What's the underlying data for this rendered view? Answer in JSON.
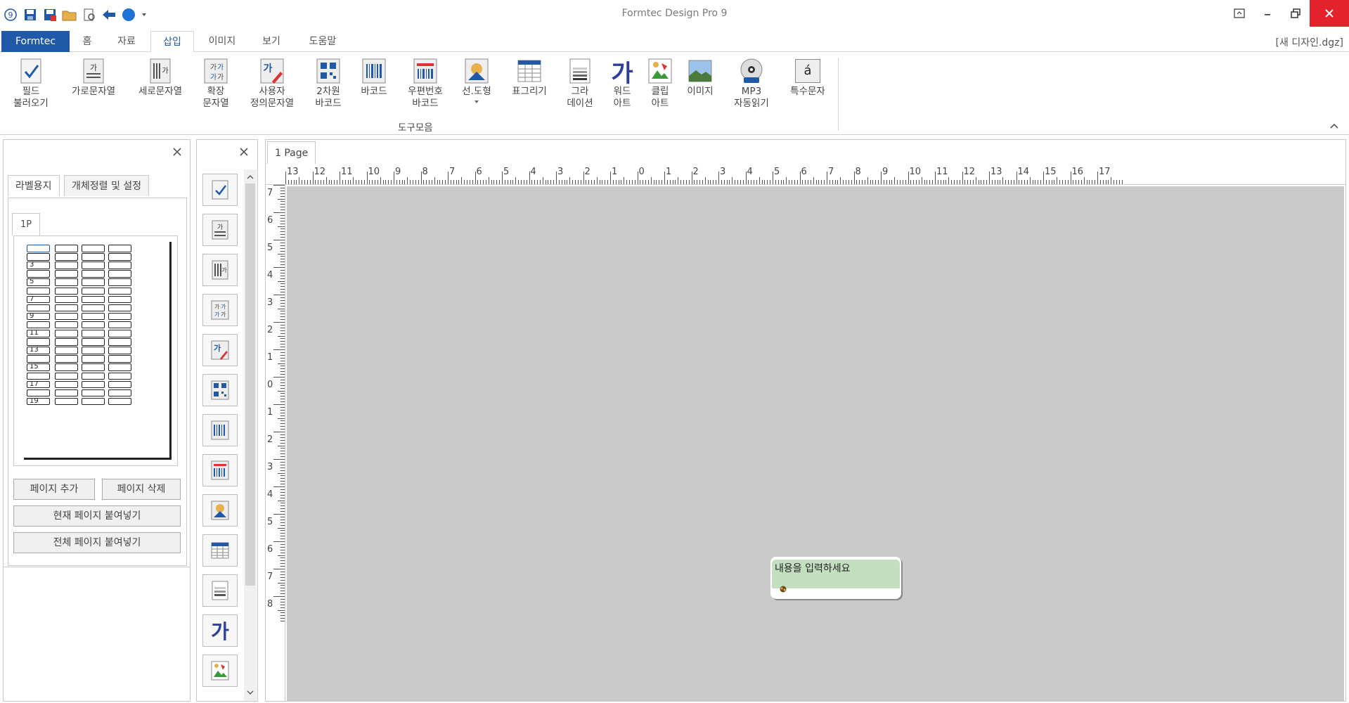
{
  "app": {
    "title": "Formtec Design Pro 9",
    "doc_name": "[새 디자인.dgz]"
  },
  "tabs": {
    "file": "Formtec",
    "home": "홈",
    "data": "자료",
    "insert": "삽입",
    "image": "이미지",
    "view": "보기",
    "help": "도움말"
  },
  "ribbon": {
    "field_load": "필드\n불러오기",
    "horizontal_text": "가로문자열",
    "vertical_text": "세로문자열",
    "extended_text": "확장\n문자열",
    "user_text": "사용자\n정의문자열",
    "barcode_2d": "2차원\n바코드",
    "barcode": "바코드",
    "postal_barcode": "우편번호\n바코드",
    "shape": "선.도형",
    "table": "표그리기",
    "gradation": "그라\n데이션",
    "word_art": "워드\n아트",
    "clip_art": "클립\n아트",
    "image": "이미지",
    "mp3": "MP3\n자동읽기",
    "special_char": "특수문자",
    "group_label": "도구모음",
    "icon_ga": "가",
    "icon_a": "á"
  },
  "left_panel": {
    "tab_label": "라벨용지",
    "tab_align": "개체정렬 및 설정",
    "page_tab": "1P",
    "row_numbers": [
      "3",
      "5",
      "7",
      "9",
      "11",
      "13",
      "15",
      "17",
      "19"
    ],
    "add_page": "페이지 추가",
    "delete_page": "페이지 삭제",
    "paste_current": "현재 페이지 붙여넣기",
    "paste_all": "전체 페이지 붙여넣기"
  },
  "canvas": {
    "page_tab": "1 Page",
    "placeholder_text": "내용을 입력하세요",
    "h_ruler_labels": [
      "13",
      "12",
      "11",
      "10",
      "9",
      "8",
      "7",
      "6",
      "5",
      "4",
      "3",
      "2",
      "1",
      "0",
      "1",
      "2",
      "3",
      "4",
      "5",
      "6",
      "7",
      "8",
      "9",
      "10",
      "11",
      "12",
      "13",
      "14",
      "15",
      "16",
      "17"
    ],
    "v_ruler_labels": [
      "7",
      "6",
      "5",
      "4",
      "3",
      "2",
      "1",
      "0",
      "1",
      "2",
      "3",
      "4",
      "5",
      "6",
      "7",
      "8"
    ]
  },
  "colors": {
    "accent": "#1f59a7",
    "close": "#e3222b",
    "label_fill": "#c3dfbf",
    "canvas_bg": "#cacaca"
  }
}
